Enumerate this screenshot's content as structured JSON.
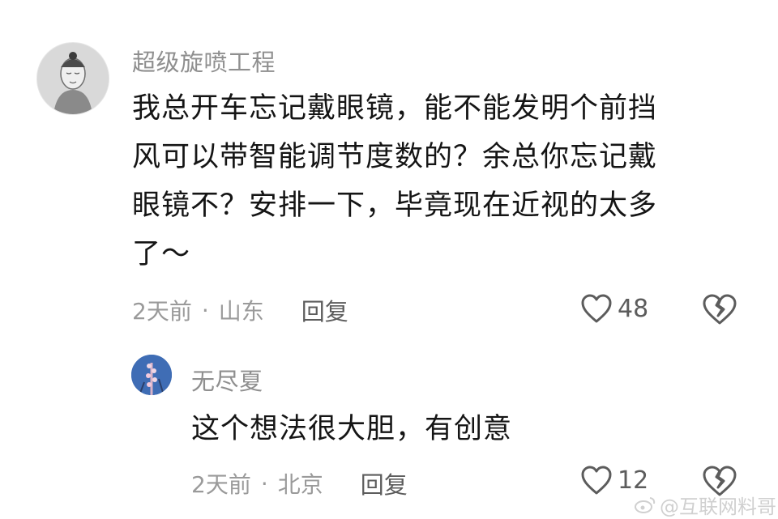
{
  "main_comment": {
    "username": "超级旋喷工程",
    "text_lines": [
      "我总开车忘记戴眼镜，能不能发明个前挡",
      "风可以带智能调节度数的？余总你忘记戴",
      "眼镜不？安排一下，毕竟现在近视的太多",
      "了～"
    ],
    "time": "2天前",
    "separator": "·",
    "location": "山东",
    "reply_label": "回复",
    "like_count": "48"
  },
  "reply_comment": {
    "username": "无尽夏",
    "text": "这个想法很大胆，有创意",
    "time": "2天前",
    "separator": "·",
    "location": "北京",
    "reply_label": "回复",
    "like_count": "12"
  },
  "watermark": {
    "text": "@互联网料哥"
  },
  "icons": {
    "like": "heart-outline-icon",
    "dislike": "broken-heart-icon",
    "weibo": "weibo-logo-icon"
  }
}
